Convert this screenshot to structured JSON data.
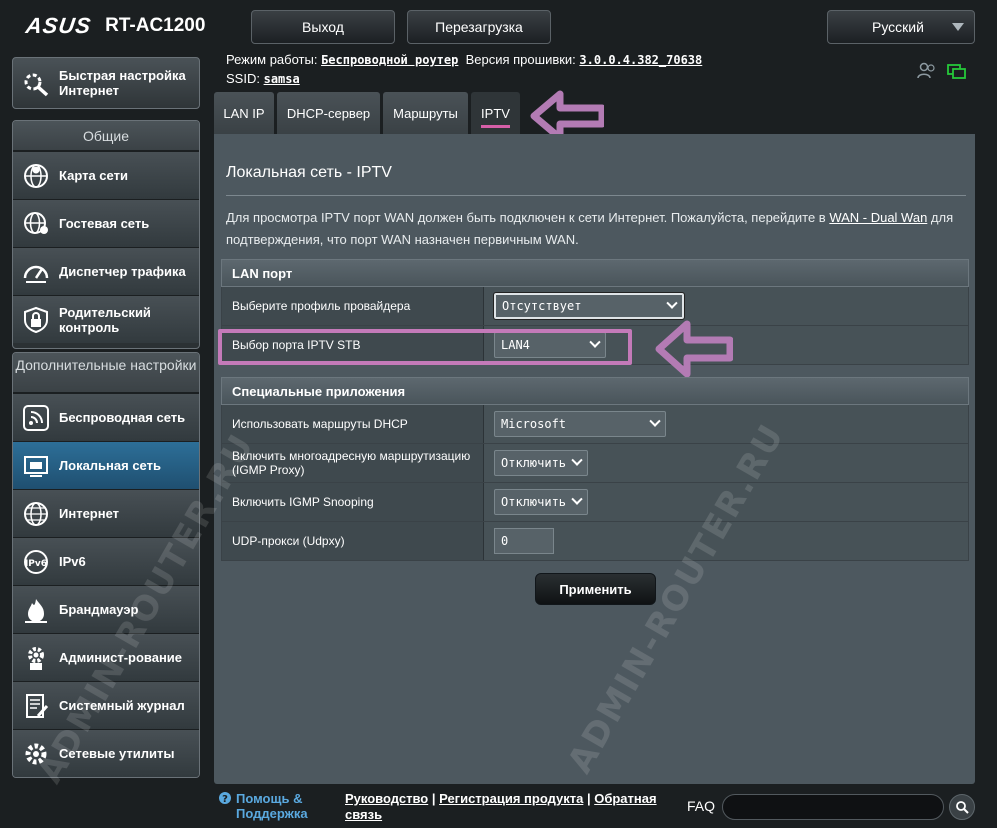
{
  "header": {
    "brand": "ASUS",
    "model": "RT-AC1200",
    "logout_label": "Выход",
    "reboot_label": "Перезагрузка",
    "language": "Русский"
  },
  "status": {
    "mode_label": "Режим работы:",
    "mode_value": "Беспроводной роутер",
    "firmware_label": "Версия прошивки:",
    "firmware_value": "3.0.0.4.382_70638",
    "ssid_label": "SSID:",
    "ssid_value": "samsa"
  },
  "sidebar": {
    "quick_setup": "Быстрая настройка Интернет",
    "general_header": "Общие",
    "general_items": [
      {
        "label": "Карта сети",
        "icon": "network-map-icon"
      },
      {
        "label": "Гостевая сеть",
        "icon": "guest-network-icon"
      },
      {
        "label": "Диспетчер трафика",
        "icon": "traffic-manager-icon"
      },
      {
        "label": "Родительский контроль",
        "icon": "parental-control-icon"
      }
    ],
    "advanced_header": "Дополнительные настройки",
    "advanced_items": [
      {
        "label": "Беспроводная сеть",
        "icon": "wireless-icon"
      },
      {
        "label": "Локальная сеть",
        "icon": "lan-icon"
      },
      {
        "label": "Интернет",
        "icon": "internet-icon"
      },
      {
        "label": "IPv6",
        "icon": "ipv6-icon"
      },
      {
        "label": "Брандмауэр",
        "icon": "firewall-icon"
      },
      {
        "label": "Админист-рование",
        "icon": "administration-icon"
      },
      {
        "label": "Системный журнал",
        "icon": "system-log-icon"
      },
      {
        "label": "Сетевые утилиты",
        "icon": "network-tools-icon"
      }
    ]
  },
  "tabs": [
    "LAN IP",
    "DHCP-сервер",
    "Маршруты",
    "IPTV"
  ],
  "main": {
    "title": "Локальная сеть - IPTV",
    "desc_before": "Для просмотра IPTV порт WAN должен быть подключен к сети Интернет. Пожалуйста, перейдите в ",
    "desc_link": "WAN - Dual Wan",
    "desc_after": " для подтверждения, что порт WAN назначен первичным WAN.",
    "lan_section": "LAN порт",
    "profile_label": "Выберите профиль провайдера",
    "profile_value": "Отсутствует",
    "stb_label": "Выбор порта IPTV STB",
    "stb_value": "LAN4",
    "special_section": "Специальные приложения",
    "dhcp_routes_label": "Использовать маршруты DHCP",
    "dhcp_routes_value": "Microsoft",
    "igmp_proxy_label": "Включить многоадресную маршрутизацию (IGMP Proxy)",
    "igmp_proxy_value": "Отключить",
    "igmp_snoop_label": "Включить IGMP Snooping",
    "igmp_snoop_value": "Отключить",
    "udpxy_label": "UDP-прокси (Udpxy)",
    "udpxy_value": "0",
    "apply_label": "Применить"
  },
  "footer": {
    "help": "Помощь & Поддержка",
    "manual": "Руководство",
    "register": "Регистрация продукта",
    "feedback": "Обратная связь",
    "faq": "FAQ"
  },
  "watermark": "ADMIN-ROUTER.RU",
  "colors": {
    "accent_pink": "#c47ab9",
    "active_blue": "#2d6f98",
    "help_blue": "#5aa9e0"
  }
}
